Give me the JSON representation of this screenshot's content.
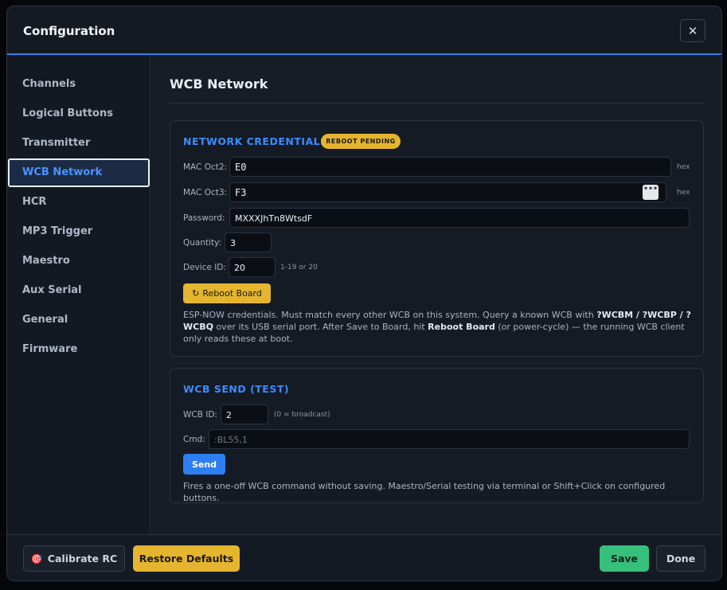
{
  "dialog": {
    "title": "Configuration",
    "close_icon": "✕"
  },
  "sidebar": {
    "items": [
      {
        "label": "Channels"
      },
      {
        "label": "Logical Buttons"
      },
      {
        "label": "Transmitter"
      },
      {
        "label": "WCB Network",
        "active": true
      },
      {
        "label": "HCR"
      },
      {
        "label": "MP3 Trigger"
      },
      {
        "label": "Maestro"
      },
      {
        "label": "Aux Serial"
      },
      {
        "label": "General"
      },
      {
        "label": "Firmware"
      }
    ]
  },
  "main": {
    "title": "WCB Network",
    "credentials": {
      "title": "NETWORK CREDENTIALS",
      "badge": "REBOOT PENDING",
      "mac_oct2": {
        "label": "MAC Oct2:",
        "value": "E0",
        "suffix": "hex"
      },
      "mac_oct3": {
        "label": "MAC Oct3:",
        "value": "F3",
        "suffix": "hex",
        "menu_icon": "•••"
      },
      "password": {
        "label": "Password:",
        "value": "MXXXJhTn8WtsdF"
      },
      "quantity": {
        "label": "Quantity:",
        "value": "3"
      },
      "device_id": {
        "label": "Device ID:",
        "value": "20",
        "hint": "1-19 or 20"
      },
      "reboot_button": {
        "icon": "↻",
        "label": "Reboot Board"
      },
      "help": {
        "p1": "ESP-NOW credentials. Must match every other WCB on this system. Query a known WCB with ",
        "b1": "?WCBM / ?WCBP / ?WCBQ",
        "p2": " over its USB serial port. After Save to Board, hit ",
        "b2": "Reboot Board",
        "p3": " (or power-cycle) — the running WCB client only reads these at boot."
      }
    },
    "send": {
      "title": "WCB SEND (TEST)",
      "wcb_id": {
        "label": "WCB ID:",
        "value": "2",
        "hint": "(0 = broadcast)"
      },
      "cmd": {
        "label": "Cmd:",
        "placeholder": ":BL55,1"
      },
      "send_button": "Send",
      "help": "Fires a one-off WCB command without saving. Maestro/Serial testing via terminal or Shift+Click on configured buttons."
    }
  },
  "footer": {
    "calibrate": {
      "icon": "🎯",
      "label": "Calibrate RC"
    },
    "restore": "Restore Defaults",
    "save": "Save",
    "done": "Done"
  }
}
